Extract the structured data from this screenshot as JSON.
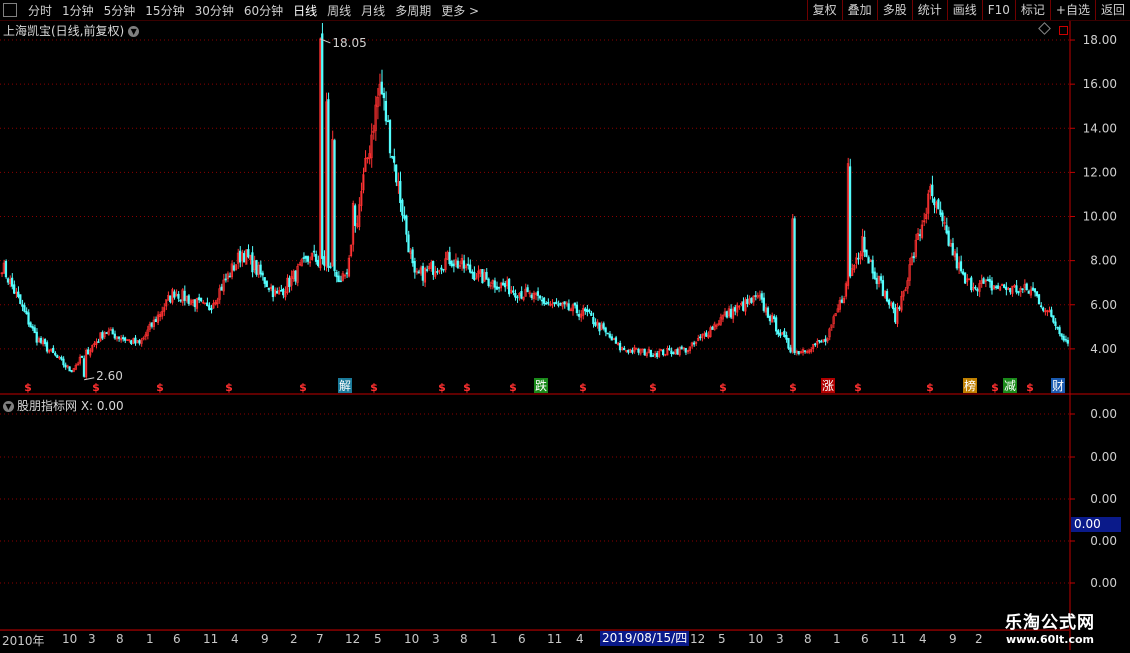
{
  "toolbar": {
    "periods": [
      "分时",
      "1分钟",
      "5分钟",
      "15分钟",
      "30分钟",
      "60分钟",
      "日线",
      "周线",
      "月线",
      "多周期",
      "更多 >"
    ],
    "active_period": "日线",
    "right_buttons": [
      "复权",
      "叠加",
      "多股",
      "统计",
      "画线",
      "F10",
      "标记",
      "+自选",
      "返回"
    ]
  },
  "main_chart": {
    "title": "上海凯宝(日线,前复权)",
    "high_label": "18.05",
    "low_label": "2.60",
    "y_ticks": [
      "18.00",
      "16.00",
      "14.00",
      "12.00",
      "10.00",
      "8.00",
      "6.00",
      "4.00"
    ],
    "markers": [
      "解",
      "跌",
      "涨",
      "榜",
      "减",
      "财"
    ],
    "dollar_marker": "$"
  },
  "sub_chart": {
    "title": "股朋指标网 X: 0.00",
    "y_ticks": [
      "0.00",
      "0.00",
      "0.00",
      "0.00",
      "0.00"
    ],
    "cursor_value": "0.00"
  },
  "date_axis": {
    "labels": [
      "2010年",
      "10",
      "3",
      "8",
      "1",
      "6",
      "11",
      "4",
      "9",
      "2",
      "7",
      "12",
      "5",
      "10",
      "3",
      "8",
      "1",
      "6",
      "11",
      "4",
      "12",
      "5",
      "10",
      "3",
      "8",
      "1",
      "6",
      "11",
      "4",
      "9",
      "2"
    ],
    "cursor_date": "2019/08/15/四"
  },
  "watermark": {
    "line1": "乐淘公式网",
    "line2": "www.60lt.com"
  },
  "colors": {
    "up": "#ff3232",
    "down": "#54ffff",
    "grid": "#8b0000",
    "axis": "#c00000"
  },
  "chart_data": {
    "type": "candlestick",
    "ylim": [
      2,
      18.5
    ],
    "x": [
      "2010",
      "2010-10",
      "2011-03",
      "2011-08",
      "2012-01",
      "2012-06",
      "2012-11",
      "2013-04",
      "2013-09",
      "2014-02",
      "2014-07",
      "2014-12",
      "2015-05",
      "2015-10",
      "2016-03",
      "2016-08",
      "2017-01",
      "2017-06",
      "2017-11",
      "2018-04",
      "2019-08",
      "2019-12",
      "2020-05",
      "2020-10",
      "2021-03",
      "2021-08",
      "2022-01",
      "2022-06",
      "2022-11",
      "2023-04",
      "2023-09",
      "2024-02"
    ],
    "close": [
      7.8,
      4.5,
      3.0,
      4.8,
      4.2,
      6.6,
      5.8,
      8.4,
      6.4,
      8.2,
      7.0,
      16.0,
      7.2,
      8.1,
      7.2,
      6.6,
      6.0,
      5.6,
      4.0,
      3.8,
      4.0,
      5.5,
      6.3,
      3.8,
      4.4,
      8.8,
      5.4,
      11.0,
      7.0,
      6.8,
      6.6,
      4.3
    ],
    "high_point": 18.05,
    "low_point": 2.6
  }
}
